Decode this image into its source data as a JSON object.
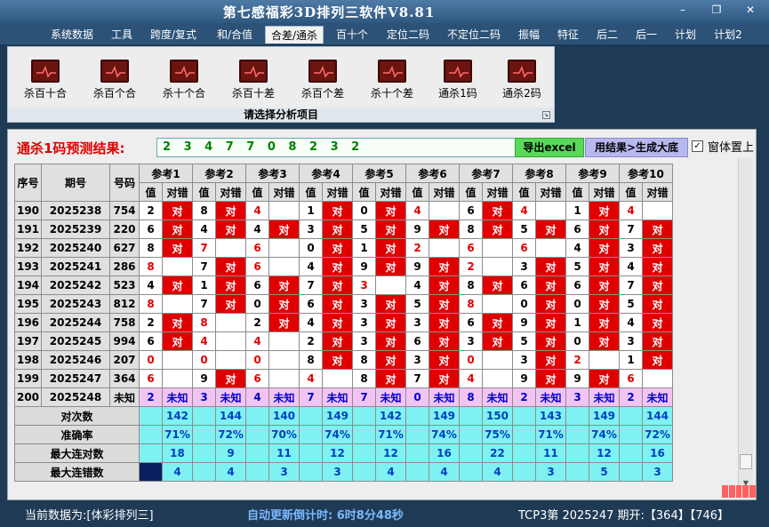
{
  "app": {
    "title": "第七感福彩3D排列三软件V8.81"
  },
  "menu": [
    "系统数据",
    "工具",
    "跨度/复式",
    "和/合值",
    "合差/通杀",
    "百十个",
    "定位二码",
    "不定位二码",
    "振幅",
    "特征",
    "后二",
    "后一",
    "计划",
    "计划2"
  ],
  "menu_active_index": 4,
  "ribbon": {
    "buttons": [
      "杀百十合",
      "杀百个合",
      "杀十个合",
      "杀百十差",
      "杀百个差",
      "杀十个差",
      "通杀1码",
      "通杀2码"
    ],
    "caption": "请选择分析项目"
  },
  "result": {
    "label": "通杀1码预测结果:",
    "value": "2 3 4 7 7 0 8 2 3 2"
  },
  "buttons": {
    "excel": "导出excel",
    "generate": "用结果>生成大底",
    "topmost": "窗体置上",
    "topmost_checked": "✓"
  },
  "table": {
    "h_seq": "序号",
    "h_issue": "期号",
    "h_num": "号码",
    "refs": [
      "参考1",
      "参考2",
      "参考3",
      "参考4",
      "参考5",
      "参考6",
      "参考7",
      "参考8",
      "参考9",
      "参考10"
    ],
    "sub_val": "值",
    "sub_dd": "对错",
    "hit_text": "对",
    "rows": [
      {
        "seq": "190",
        "issue": "2025238",
        "num": "754",
        "vals": [
          "2",
          "8",
          "4",
          "1",
          "0",
          "4",
          "6",
          "4",
          "1",
          "4"
        ],
        "hits": [
          1,
          1,
          0,
          1,
          1,
          0,
          1,
          0,
          1,
          0
        ],
        "red": [
          0,
          0,
          1,
          0,
          0,
          1,
          0,
          1,
          0,
          1
        ]
      },
      {
        "seq": "191",
        "issue": "2025239",
        "num": "220",
        "vals": [
          "6",
          "4",
          "4",
          "3",
          "5",
          "9",
          "8",
          "5",
          "6",
          "7"
        ],
        "hits": [
          1,
          1,
          1,
          1,
          1,
          1,
          1,
          1,
          1,
          1
        ],
        "red": [
          0,
          0,
          0,
          0,
          0,
          0,
          0,
          0,
          0,
          0
        ]
      },
      {
        "seq": "192",
        "issue": "2025240",
        "num": "627",
        "vals": [
          "8",
          "7",
          "6",
          "0",
          "1",
          "2",
          "6",
          "6",
          "4",
          "3"
        ],
        "hits": [
          1,
          0,
          0,
          1,
          1,
          0,
          0,
          0,
          1,
          1
        ],
        "red": [
          0,
          1,
          1,
          0,
          0,
          1,
          1,
          1,
          0,
          0
        ]
      },
      {
        "seq": "193",
        "issue": "2025241",
        "num": "286",
        "vals": [
          "8",
          "7",
          "6",
          "4",
          "9",
          "9",
          "2",
          "3",
          "5",
          "4"
        ],
        "hits": [
          0,
          1,
          0,
          1,
          1,
          1,
          0,
          1,
          1,
          1
        ],
        "red": [
          1,
          0,
          1,
          0,
          0,
          0,
          1,
          0,
          0,
          0
        ]
      },
      {
        "seq": "194",
        "issue": "2025242",
        "num": "523",
        "vals": [
          "4",
          "1",
          "6",
          "7",
          "3",
          "4",
          "8",
          "6",
          "6",
          "7"
        ],
        "hits": [
          1,
          1,
          1,
          1,
          0,
          1,
          1,
          1,
          1,
          1
        ],
        "red": [
          0,
          0,
          0,
          0,
          1,
          0,
          0,
          0,
          0,
          0
        ]
      },
      {
        "seq": "195",
        "issue": "2025243",
        "num": "812",
        "vals": [
          "8",
          "7",
          "0",
          "6",
          "3",
          "5",
          "8",
          "0",
          "0",
          "5"
        ],
        "hits": [
          0,
          1,
          1,
          1,
          1,
          1,
          0,
          1,
          1,
          1
        ],
        "red": [
          1,
          0,
          0,
          0,
          0,
          0,
          1,
          0,
          0,
          0
        ]
      },
      {
        "seq": "196",
        "issue": "2025244",
        "num": "758",
        "vals": [
          "2",
          "8",
          "2",
          "4",
          "3",
          "3",
          "6",
          "9",
          "1",
          "4"
        ],
        "hits": [
          1,
          0,
          1,
          1,
          1,
          1,
          1,
          1,
          1,
          1
        ],
        "red": [
          0,
          1,
          0,
          0,
          0,
          0,
          0,
          0,
          0,
          0
        ]
      },
      {
        "seq": "197",
        "issue": "2025245",
        "num": "994",
        "vals": [
          "6",
          "4",
          "4",
          "2",
          "3",
          "6",
          "3",
          "5",
          "0",
          "3"
        ],
        "hits": [
          1,
          0,
          0,
          1,
          1,
          1,
          1,
          1,
          1,
          1
        ],
        "red": [
          0,
          1,
          1,
          0,
          0,
          0,
          0,
          0,
          0,
          0
        ]
      },
      {
        "seq": "198",
        "issue": "2025246",
        "num": "207",
        "vals": [
          "0",
          "0",
          "0",
          "8",
          "8",
          "3",
          "0",
          "3",
          "2",
          "1"
        ],
        "hits": [
          0,
          0,
          0,
          1,
          1,
          1,
          0,
          1,
          0,
          1
        ],
        "red": [
          1,
          1,
          1,
          0,
          0,
          0,
          1,
          0,
          1,
          0
        ]
      },
      {
        "seq": "199",
        "issue": "2025247",
        "num": "364",
        "vals": [
          "6",
          "9",
          "6",
          "4",
          "8",
          "7",
          "4",
          "9",
          "9",
          "6"
        ],
        "hits": [
          0,
          1,
          0,
          0,
          1,
          1,
          0,
          1,
          1,
          0
        ],
        "red": [
          1,
          0,
          1,
          1,
          0,
          0,
          1,
          0,
          0,
          1
        ]
      }
    ],
    "predict": {
      "seq": "200",
      "issue": "2025248",
      "num": "未知",
      "vals": [
        "2",
        "3",
        "4",
        "7",
        "7",
        "0",
        "8",
        "2",
        "3",
        "2"
      ],
      "dd": "未知"
    },
    "stats": [
      {
        "label": "对次数",
        "vals": [
          "142",
          "144",
          "140",
          "149",
          "142",
          "149",
          "150",
          "143",
          "149",
          "144"
        ]
      },
      {
        "label": "准确率",
        "vals": [
          "71%",
          "72%",
          "70%",
          "74%",
          "71%",
          "74%",
          "75%",
          "71%",
          "74%",
          "72%"
        ]
      },
      {
        "label": "最大连对数",
        "vals": [
          "18",
          "9",
          "11",
          "12",
          "12",
          "16",
          "22",
          "11",
          "12",
          "16"
        ]
      },
      {
        "label": "最大连错数",
        "vals": [
          "4",
          "4",
          "3",
          "3",
          "4",
          "4",
          "4",
          "3",
          "5",
          "3"
        ]
      }
    ]
  },
  "status": {
    "current": "当前数据为:[体彩排列三]",
    "countdown": "自动更新倒计时: 6时8分48秒",
    "issue": "TCP3第 2025247 期开:【364】【746】"
  }
}
